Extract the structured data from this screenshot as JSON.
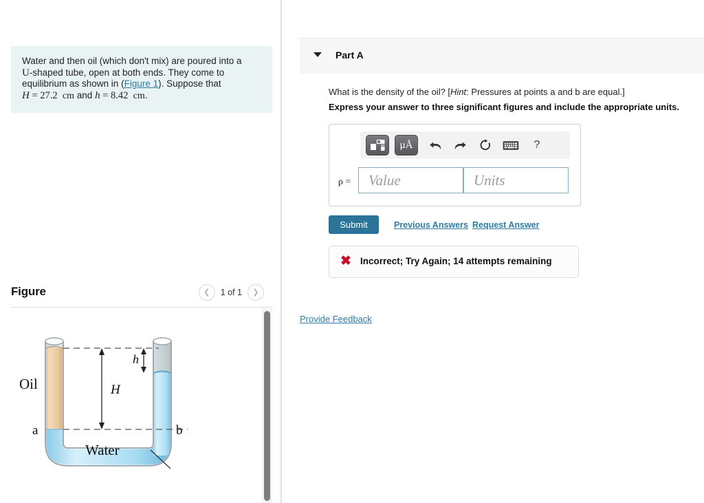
{
  "left_panel": {
    "problem": {
      "line1": "Water and then oil (which don't mix) are poured into a",
      "u_symbol": "U",
      "line2_rest": "-shaped tube, open at both ends. They come to",
      "line3_pre": "equilibrium as shown in (",
      "figure_link": "Figure 1",
      "line3_post": "). Suppose that",
      "var_H": "H",
      "eq_H": "= 27.2",
      "unit_H": "cm",
      "and_word": "and",
      "var_h": "h",
      "eq_h": "= 8.42",
      "unit_h": "cm",
      "period": "."
    },
    "figure_section": {
      "title": "Figure",
      "prev_icon": "chevron-left-icon",
      "count_label": "1 of 1",
      "next_icon": "chevron-right-icon"
    },
    "figure_diagram": {
      "label_oil": "Oil",
      "label_water": "Water",
      "label_a": "a",
      "label_b": "b",
      "label_H": "H",
      "label_h": "h",
      "oil_color": "#e9c79b",
      "water_color": "#a9dcf3",
      "tube_outline_color": "#9aa5ab",
      "dash_color": "#555555"
    }
  },
  "right_panel": {
    "part_header": {
      "caret_icon": "caret-down-icon",
      "title": "Part A"
    },
    "question": {
      "pre_hint": "What is the density of the oil? [",
      "hint_word": "Hint",
      "post_hint": ": Pressures at points a and b are equal.]",
      "instruction": "Express your answer to three significant figures and include the appropriate units."
    },
    "answer_widget": {
      "template_button_icon": "math-template-icon",
      "units_button_label": "μÅ",
      "undo_icon": "undo-arrow-icon",
      "redo_icon": "redo-arrow-icon",
      "reset_icon": "reset-circular-arrow-icon",
      "keyboard_icon": "keyboard-icon",
      "help_label": "?",
      "rho_label": "ρ =",
      "value_placeholder": "Value",
      "value_current": "",
      "units_placeholder": "Units",
      "units_current": ""
    },
    "actions": {
      "submit_label": "Submit",
      "previous_answers_label": "Previous Answers",
      "request_answer_label": "Request Answer"
    },
    "feedback": {
      "status_icon": "red-x-icon",
      "message": "Incorrect; Try Again; 14 attempts remaining",
      "accent_color": "#c8102e"
    },
    "provide_feedback_label": "Provide Feedback"
  },
  "theme": {
    "link_color": "#2e7ca5",
    "submit_color": "#2b7399",
    "problem_bg": "#eaf3f4",
    "header_bg": "#f7f7f7"
  }
}
